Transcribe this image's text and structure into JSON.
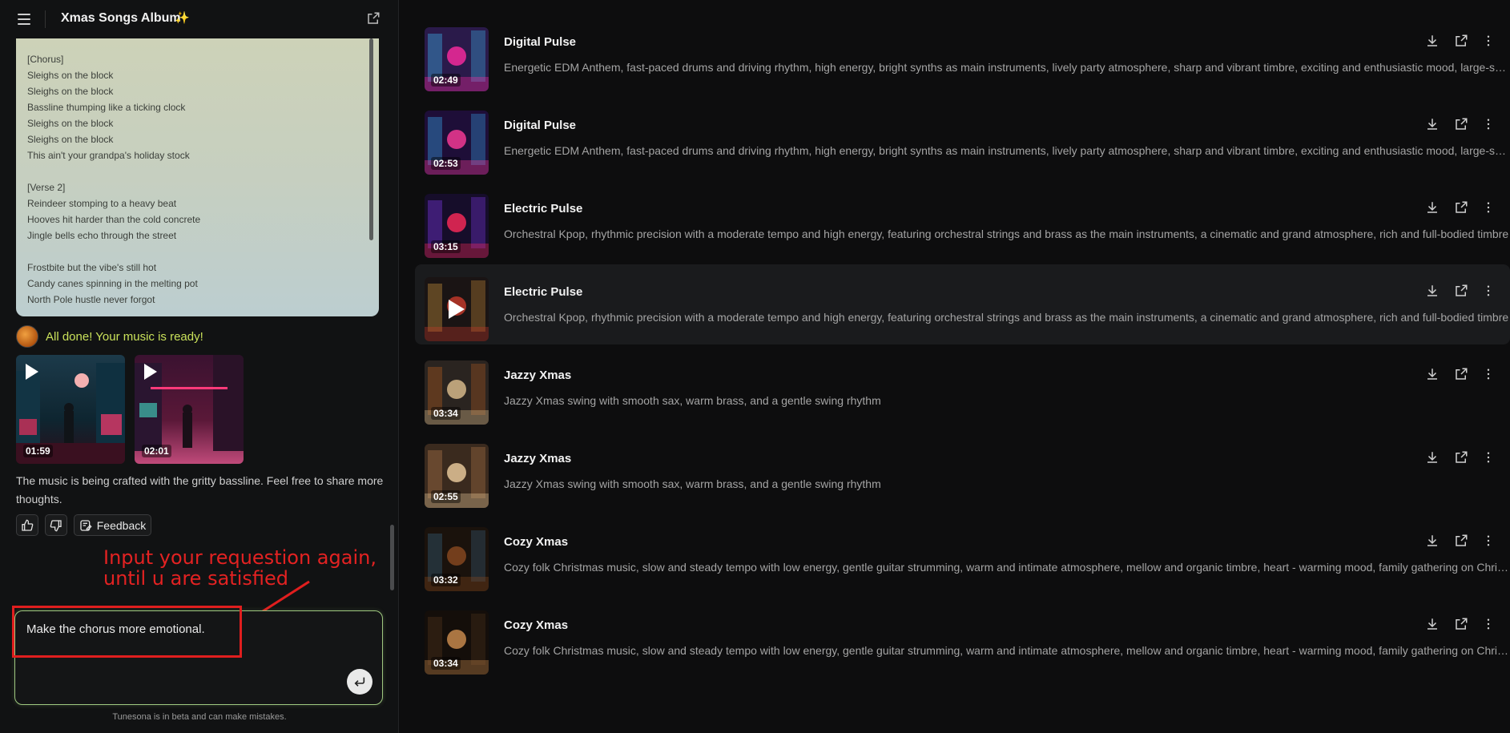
{
  "header": {
    "title": "Xmas Songs Album"
  },
  "lyrics": [
    "[Chorus]",
    "Sleighs on the block",
    "Sleighs on the block",
    "Bassline thumping like a ticking clock",
    "Sleighs on the block",
    "Sleighs on the block",
    "This ain't your grandpa's holiday stock",
    "",
    "[Verse 2]",
    "Reindeer stomping to a heavy beat",
    "Hooves hit harder than the cold concrete",
    "Jingle bells echo through the street",
    "",
    "Frostbite but the vibe's still hot",
    "Candy canes spinning in the melting pot",
    "North Pole hustle never forgot"
  ],
  "chat": {
    "ready_text": "All done! Your music is ready!",
    "results": [
      {
        "duration": "01:59"
      },
      {
        "duration": "02:01"
      }
    ],
    "crafted_text": "The music is being crafted with the gritty bassline. Feel free to share more thoughts.",
    "feedback_label": "Feedback",
    "annotation_line1": "Input your requestion again,",
    "annotation_line2": "until u are satisfied",
    "input_value": "Make the chorus more emotional.",
    "beta_note": "Tunesona is in beta and can make mistakes."
  },
  "songs": [
    {
      "title": "Digital Pulse",
      "duration": "02:49",
      "desc": "Energetic EDM Anthem, fast-paced drums and driving rhythm, high energy, bright synths as main instruments, lively party atmosphere, sharp and vibrant timbre, exciting and enthusiastic mood, large-scale club event"
    },
    {
      "title": "Digital Pulse",
      "duration": "02:53",
      "desc": "Energetic EDM Anthem, fast-paced drums and driving rhythm, high energy, bright synths as main instruments, lively party atmosphere, sharp and vibrant timbre, exciting and enthusiastic mood, large-scale club event"
    },
    {
      "title": "Electric Pulse",
      "duration": "03:15",
      "desc": "Orchestral Kpop, rhythmic precision with a moderate tempo and high energy, featuring orchestral strings and brass as the main instruments, a cinematic and grand atmosphere, rich and full-bodied timbre"
    },
    {
      "title": "Electric Pulse",
      "duration": "",
      "desc": "Orchestral Kpop, rhythmic precision with a moderate tempo and high energy, featuring orchestral strings and brass as the main instruments, a cinematic and grand atmosphere, rich and full-bodied timbre"
    },
    {
      "title": "Jazzy Xmas",
      "duration": "03:34",
      "desc": "Jazzy Xmas swing with smooth sax, warm brass, and a gentle swing rhythm"
    },
    {
      "title": "Jazzy Xmas",
      "duration": "02:55",
      "desc": "Jazzy Xmas swing with smooth sax, warm brass, and a gentle swing rhythm"
    },
    {
      "title": "Cozy Xmas",
      "duration": "03:32",
      "desc": "Cozy folk Christmas music, slow and steady tempo with low energy, gentle guitar strumming, warm and intimate atmosphere, mellow and organic timbre, heart - warming mood, family gathering on Christmas Eve"
    },
    {
      "title": "Cozy Xmas",
      "duration": "03:34",
      "desc": "Cozy folk Christmas music, slow and steady tempo with low energy, gentle guitar strumming, warm and intimate atmosphere, mellow and organic timbre, heart - warming mood, family gathering on Christmas Eve"
    }
  ],
  "colors": {
    "accent_green": "#c9e15a",
    "annotation_red": "#e01e1e",
    "input_border": "#9ec77f"
  }
}
